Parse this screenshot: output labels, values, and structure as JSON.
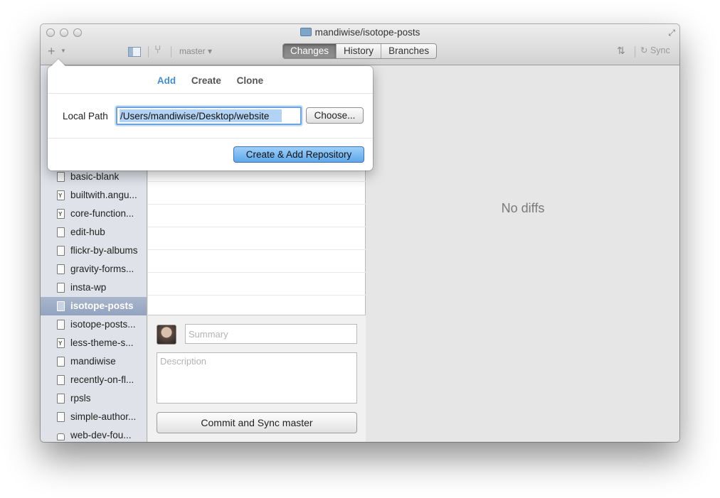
{
  "window": {
    "title": "mandiwise/isotope-posts"
  },
  "toolbar": {
    "add_icon": "plus-icon",
    "branch": "master",
    "sync_label": "Sync",
    "tabs": [
      {
        "label": "Changes",
        "active": true
      },
      {
        "label": "History",
        "active": false
      },
      {
        "label": "Branches",
        "active": false
      }
    ]
  },
  "popover": {
    "tabs": [
      {
        "label": "Add",
        "active": true
      },
      {
        "label": "Create",
        "active": false
      },
      {
        "label": "Clone",
        "active": false
      }
    ],
    "local_path_label": "Local Path",
    "local_path_value": "/Users/mandiwise/Desktop/website",
    "choose_label": "Choose...",
    "create_button_label": "Create & Add Repository"
  },
  "sidebar": {
    "repos": [
      {
        "name": "basic-blank",
        "icon": "repo-icon"
      },
      {
        "name": "builtwith.angu...",
        "icon": "fork-icon"
      },
      {
        "name": "core-function...",
        "icon": "fork-icon"
      },
      {
        "name": "edit-hub",
        "icon": "repo-icon"
      },
      {
        "name": "flickr-by-albums",
        "icon": "repo-icon"
      },
      {
        "name": "gravity-forms...",
        "icon": "repo-icon"
      },
      {
        "name": "insta-wp",
        "icon": "repo-icon"
      },
      {
        "name": "isotope-posts",
        "icon": "repo-icon",
        "selected": true
      },
      {
        "name": "isotope-posts...",
        "icon": "repo-icon"
      },
      {
        "name": "less-theme-s...",
        "icon": "fork-icon"
      },
      {
        "name": "mandiwise",
        "icon": "repo-icon"
      },
      {
        "name": "recently-on-fl...",
        "icon": "repo-icon"
      },
      {
        "name": "rpsls",
        "icon": "repo-icon"
      },
      {
        "name": "simple-author...",
        "icon": "repo-icon"
      },
      {
        "name": "web-dev-fou...",
        "icon": "lock-icon"
      }
    ]
  },
  "commit": {
    "summary_placeholder": "Summary",
    "description_placeholder": "Description",
    "commit_button_label": "Commit and Sync master"
  },
  "diff": {
    "empty_text": "No diffs"
  }
}
